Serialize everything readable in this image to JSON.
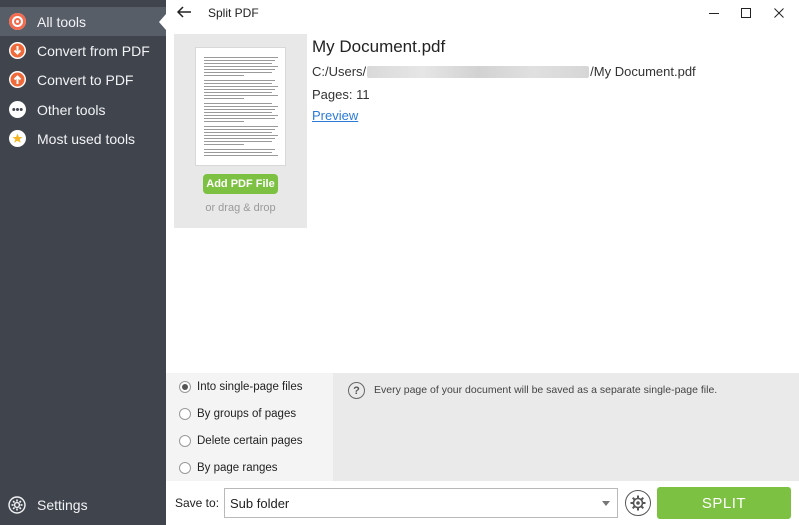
{
  "sidebar": {
    "items": [
      {
        "label": "All tools",
        "icon": "all-tools-target-icon",
        "active": true
      },
      {
        "label": "Convert from PDF",
        "icon": "arrow-down-circle-icon"
      },
      {
        "label": "Convert to PDF",
        "icon": "arrow-up-circle-icon"
      },
      {
        "label": "Other tools",
        "icon": "more-dots-icon"
      },
      {
        "label": "Most used tools",
        "icon": "star-icon"
      }
    ],
    "settings_label": "Settings"
  },
  "titlebar": {
    "title": "Split PDF"
  },
  "file": {
    "add_button": "Add PDF File",
    "drag_hint": "or drag & drop",
    "name": "My Document.pdf",
    "path_prefix": "C:/Users/",
    "path_suffix": "/My Document.pdf",
    "pages": "Pages: 11",
    "preview_link": "Preview"
  },
  "options": {
    "items": [
      {
        "label": "Into single-page files",
        "selected": true
      },
      {
        "label": "By groups of pages",
        "selected": false
      },
      {
        "label": "Delete certain pages",
        "selected": false
      },
      {
        "label": "By page ranges",
        "selected": false
      }
    ],
    "info_text": "Every page of your document will be saved as a separate single-page file."
  },
  "bottom": {
    "save_label": "Save to:",
    "save_value": "Sub folder",
    "split_label": "SPLIT"
  },
  "colors": {
    "sidebar_bg": "#3f444d",
    "accent_green": "#7cc142",
    "link_blue": "#2a7bd6"
  }
}
